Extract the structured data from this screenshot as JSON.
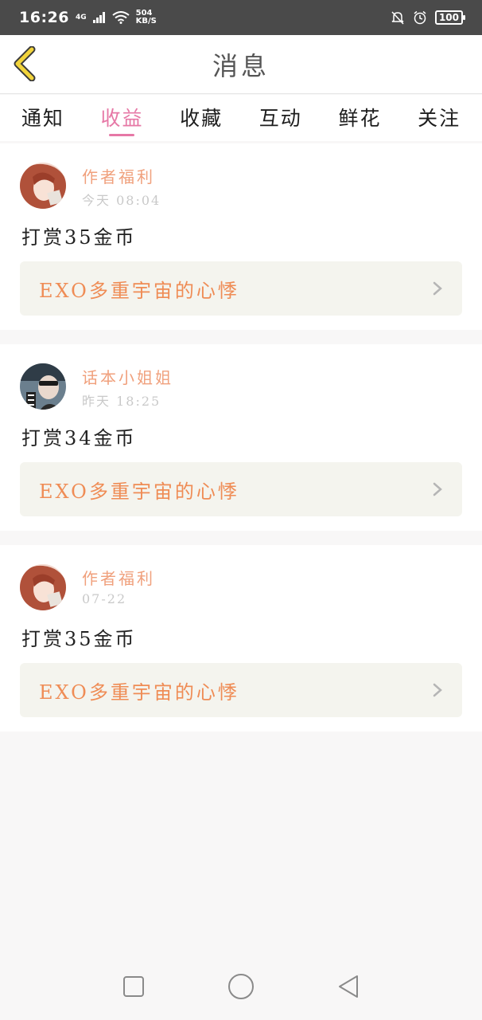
{
  "status_bar": {
    "time": "16:26",
    "network": "4G",
    "speed_value": "504",
    "speed_unit": "KB/S",
    "battery": "100"
  },
  "header": {
    "title": "消息",
    "back_icon": "chevron-left-icon"
  },
  "tabs": [
    {
      "label": "通知",
      "active": false
    },
    {
      "label": "收益",
      "active": true
    },
    {
      "label": "收藏",
      "active": false
    },
    {
      "label": "互动",
      "active": false
    },
    {
      "label": "鲜花",
      "active": false
    },
    {
      "label": "关注",
      "active": false
    }
  ],
  "messages": [
    {
      "sender": "作者福利",
      "time": "今天 08:04",
      "message": "打赏35金币",
      "book": "EXO多重宇宙的心悸"
    },
    {
      "sender": "话本小姐姐",
      "time": "昨天 18:25",
      "message": "打赏34金币",
      "book": "EXO多重宇宙的心悸"
    },
    {
      "sender": "作者福利",
      "time": "07-22",
      "message": "打赏35金币",
      "book": "EXO多重宇宙的心悸"
    }
  ],
  "colors": {
    "accent_pink": "#e678a6",
    "sender_orange": "#f0a07c",
    "book_orange": "#ef8c55",
    "back_yellow": "#f2d43b"
  }
}
